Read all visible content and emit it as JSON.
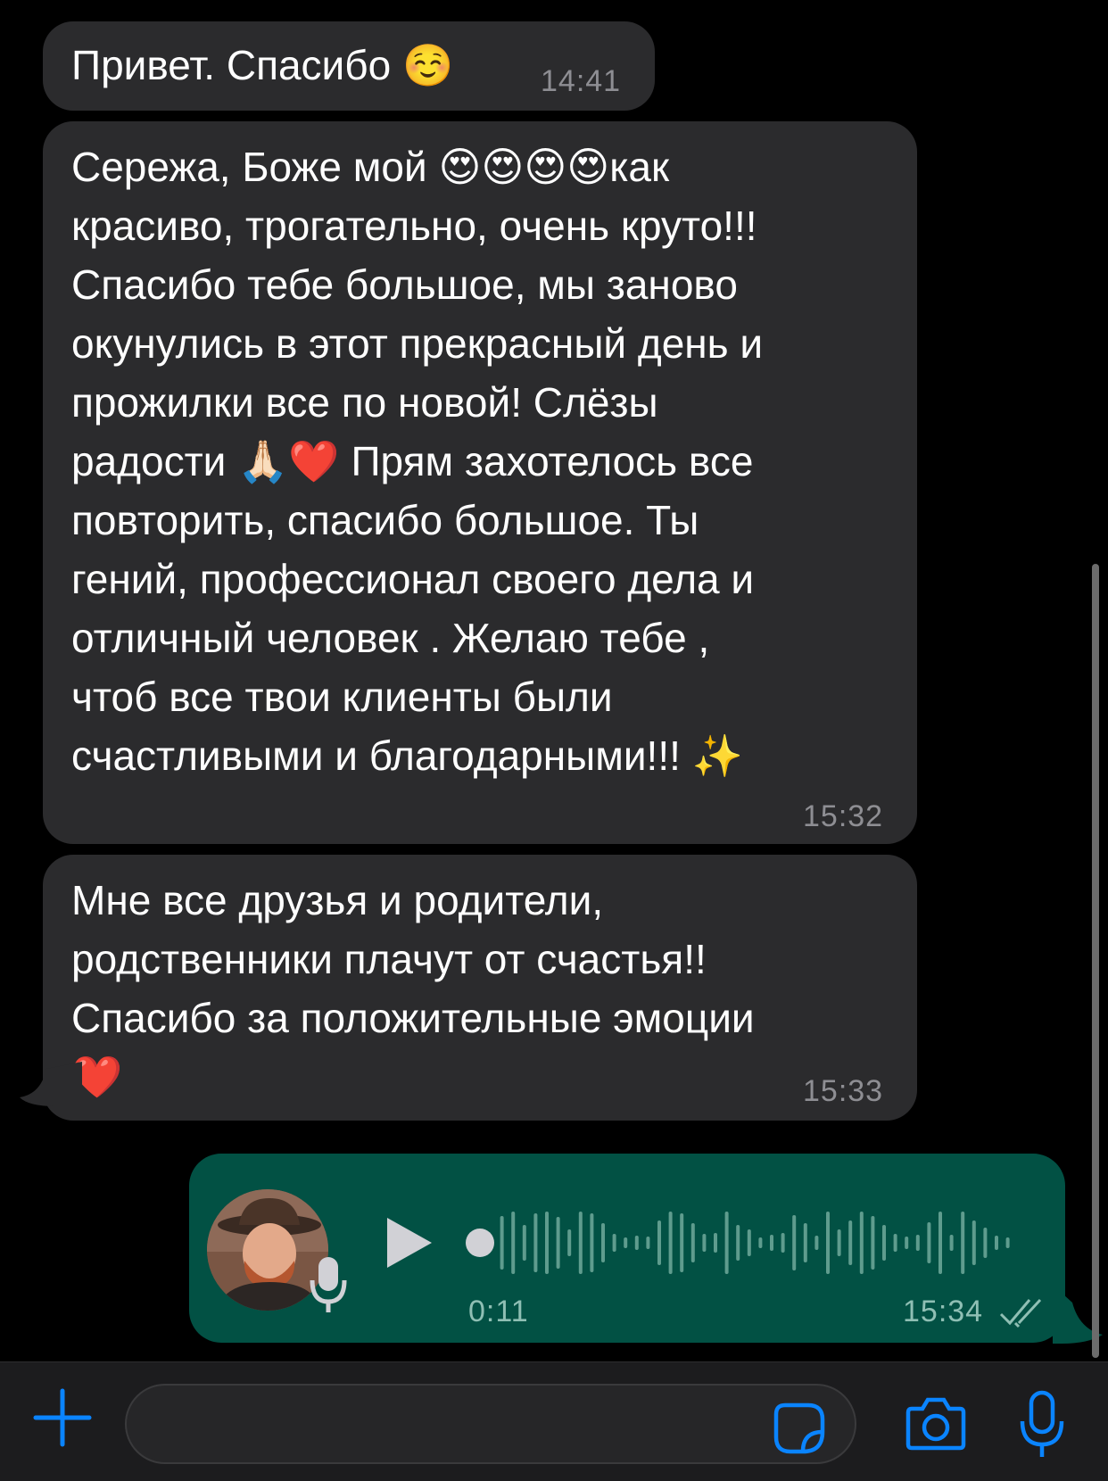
{
  "messages": [
    {
      "text": "Привет. Спасибо ☺️",
      "time": "14:41"
    },
    {
      "text": "Сережа, Боже мой 😍😍😍😍как\nкрасиво, трогательно, очень круто!!!\nСпасибо тебе большое, мы заново\nокунулись в этот прекрасный день и\nпрожилки все по новой! Слёзы\nрадости 🙏🏻❤️ Прям захотелось все\nповторить, спасибо большое. Ты\nгений, профессионал своего дела и\nотличный человек . Желаю тебе ,\nчтоб все твои клиенты были\nсчастливыми и благодарными!!! ✨",
      "time": "15:32"
    },
    {
      "text": "Мне все друзья и родители,\nродственники плачут от счастья!!\nСпасибо за положительные эмоции\n❤️",
      "time": "15:33"
    }
  ],
  "voice_message": {
    "duration": "0:11",
    "time": "15:34",
    "progress": 0,
    "status": "read"
  },
  "input_bar": {
    "placeholder": ""
  },
  "colors": {
    "incoming_bubble": "#2b2b2d",
    "outgoing_bubble": "#025144",
    "accent": "#0a84ff",
    "timestamp": "#8e8e93"
  },
  "icons": {
    "attach": "plus-icon",
    "sticker": "sticker-icon",
    "camera": "camera-icon",
    "voice": "microphone-icon",
    "play": "play-icon",
    "read_receipt": "double-check-icon"
  }
}
